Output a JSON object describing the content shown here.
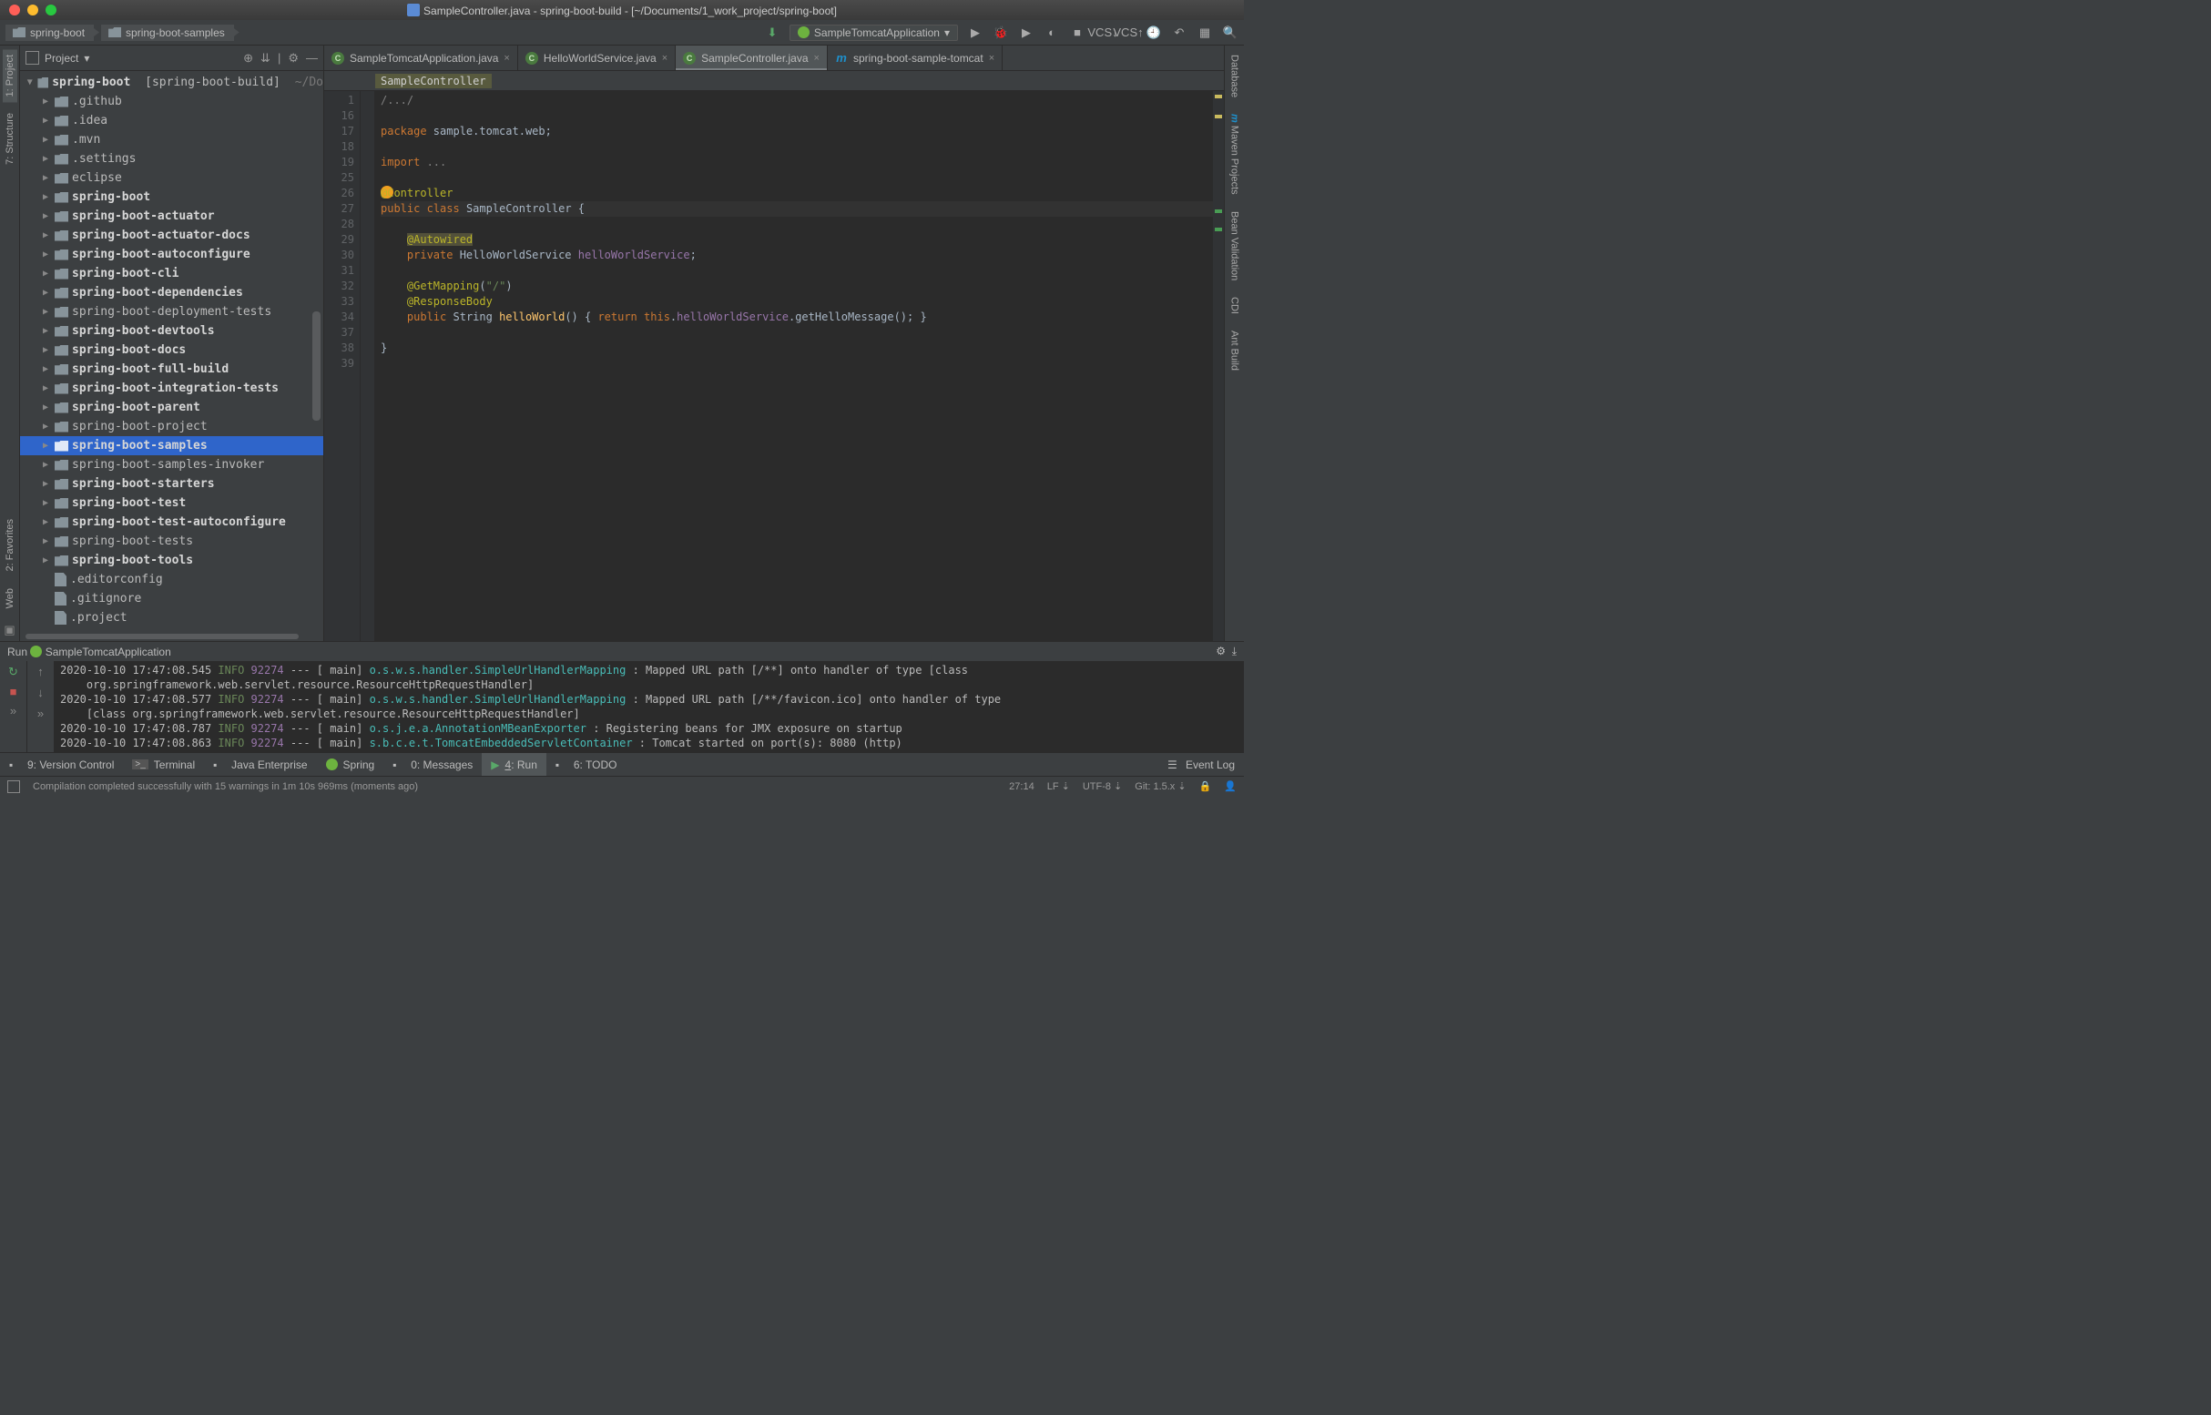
{
  "title": "SampleController.java - spring-boot-build - [~/Documents/1_work_project/spring-boot]",
  "breadcrumb": [
    "spring-boot",
    "spring-boot-samples"
  ],
  "runconfig": "SampleTomcatApplication",
  "leftTools": [
    {
      "label": "1: Project",
      "icon": "project"
    },
    {
      "label": "7: Structure",
      "icon": "structure"
    },
    {
      "label": "2: Favorites",
      "icon": "star"
    },
    {
      "label": "Web",
      "icon": "web"
    }
  ],
  "rightTools": [
    {
      "label": "Database",
      "icon": "db"
    },
    {
      "label": "Maven Projects",
      "icon": "maven"
    },
    {
      "label": "Bean Validation",
      "icon": "bean"
    },
    {
      "label": "CDI",
      "icon": "cdi"
    },
    {
      "label": "Ant Build",
      "icon": "ant"
    }
  ],
  "projectPanel": {
    "title": "Project",
    "root": {
      "name": "spring-boot",
      "qualifier": "[spring-boot-build]",
      "path": "~/Do"
    },
    "items": [
      {
        "name": ".github",
        "bold": false
      },
      {
        "name": ".idea",
        "bold": false
      },
      {
        "name": ".mvn",
        "bold": false
      },
      {
        "name": ".settings",
        "bold": false
      },
      {
        "name": "eclipse",
        "bold": false
      },
      {
        "name": "spring-boot",
        "bold": true
      },
      {
        "name": "spring-boot-actuator",
        "bold": true
      },
      {
        "name": "spring-boot-actuator-docs",
        "bold": true
      },
      {
        "name": "spring-boot-autoconfigure",
        "bold": true
      },
      {
        "name": "spring-boot-cli",
        "bold": true
      },
      {
        "name": "spring-boot-dependencies",
        "bold": true
      },
      {
        "name": "spring-boot-deployment-tests",
        "bold": false
      },
      {
        "name": "spring-boot-devtools",
        "bold": true
      },
      {
        "name": "spring-boot-docs",
        "bold": true
      },
      {
        "name": "spring-boot-full-build",
        "bold": true
      },
      {
        "name": "spring-boot-integration-tests",
        "bold": true
      },
      {
        "name": "spring-boot-parent",
        "bold": true
      },
      {
        "name": "spring-boot-project",
        "bold": false
      },
      {
        "name": "spring-boot-samples",
        "bold": true,
        "selected": true
      },
      {
        "name": "spring-boot-samples-invoker",
        "bold": false
      },
      {
        "name": "spring-boot-starters",
        "bold": true
      },
      {
        "name": "spring-boot-test",
        "bold": true
      },
      {
        "name": "spring-boot-test-autoconfigure",
        "bold": true
      },
      {
        "name": "spring-boot-tests",
        "bold": false
      },
      {
        "name": "spring-boot-tools",
        "bold": true
      }
    ],
    "files": [
      {
        "name": ".editorconfig"
      },
      {
        "name": ".gitignore"
      },
      {
        "name": ".project"
      }
    ]
  },
  "tabs": [
    {
      "label": "SampleTomcatApplication.java",
      "icon": "class",
      "active": false
    },
    {
      "label": "HelloWorldService.java",
      "icon": "class",
      "active": false
    },
    {
      "label": "SampleController.java",
      "icon": "class",
      "active": true
    },
    {
      "label": "spring-boot-sample-tomcat",
      "icon": "m",
      "active": false
    }
  ],
  "crumbBar": "SampleController",
  "gutterLines": [
    "1",
    "16",
    "17",
    "18",
    "19",
    "25",
    "26",
    "27",
    "28",
    "29",
    "30",
    "31",
    "32",
    "33",
    "34",
    "37",
    "38",
    "39"
  ],
  "code": {
    "l1": "/.../",
    "l3_kw": "package",
    "l3_rest": " sample.tomcat.web;",
    "l5_kw": "import",
    "l5_rest": " ...",
    "l7_ann": "@Controller",
    "l8_kw1": "public",
    "l8_kw2": "class",
    "l8_cls": "SampleController",
    "l8_rest": " {",
    "l10_ann": "@Autowired",
    "l11_kw": "private",
    "l11_type": " HelloWorldService ",
    "l11_fld": "helloWorldService",
    "l11_end": ";",
    "l13_ann": "@GetMapping",
    "l13_par": "(",
    "l13_str": "\"/\"",
    "l13_par2": ")",
    "l14_ann": "@ResponseBody",
    "l15_kw": "public",
    "l15_type": " String ",
    "l15_mtd": "helloWorld",
    "l15_rest1": "() { ",
    "l15_kw2": "return ",
    "l15_this": "this",
    "l15_dot": ".",
    "l15_fld": "helloWorldService",
    "l15_dot2": ".getHelloMessage(); }",
    "l17": "}"
  },
  "runHeader": {
    "label": "Run",
    "config": "SampleTomcatApplication"
  },
  "consoleLines": [
    {
      "ts": "2020-10-10 17:47:08.545",
      "lvl": "INFO",
      "pid": "92274",
      "thread": "main",
      "pkg": "o.s.w.s.handler.SimpleUrlHandlerMapping",
      "msg": ": Mapped URL path [/**] onto handler of type [class"
    },
    {
      "cont": "org.springframework.web.servlet.resource.ResourceHttpRequestHandler]"
    },
    {
      "ts": "2020-10-10 17:47:08.577",
      "lvl": "INFO",
      "pid": "92274",
      "thread": "main",
      "pkg": "o.s.w.s.handler.SimpleUrlHandlerMapping",
      "msg": ": Mapped URL path [/**/favicon.ico] onto handler of type"
    },
    {
      "cont": "[class org.springframework.web.servlet.resource.ResourceHttpRequestHandler]"
    },
    {
      "ts": "2020-10-10 17:47:08.787",
      "lvl": "INFO",
      "pid": "92274",
      "thread": "main",
      "pkg": "o.s.j.e.a.AnnotationMBeanExporter",
      "msg": ": Registering beans for JMX exposure on startup"
    },
    {
      "ts": "2020-10-10 17:47:08.863",
      "lvl": "INFO",
      "pid": "92274",
      "thread": "main",
      "pkg": "s.b.c.e.t.TomcatEmbeddedServletContainer",
      "msg": ": Tomcat started on port(s): 8080 (http)"
    }
  ],
  "bottomButtons": [
    {
      "label": "9: Version Control",
      "icon": "vcs"
    },
    {
      "label": "Terminal",
      "icon": "term"
    },
    {
      "label": "Java Enterprise",
      "icon": "jee"
    },
    {
      "label": "Spring",
      "icon": "spring"
    },
    {
      "label": "0: Messages",
      "icon": "msg"
    },
    {
      "label": "4: Run",
      "icon": "run",
      "active": true
    },
    {
      "label": "6: TODO",
      "icon": "todo"
    }
  ],
  "eventLog": "Event Log",
  "status": {
    "msg": "Compilation completed successfully with 15 warnings in 1m 10s 969ms (moments ago)",
    "pos": "27:14",
    "lf": "LF",
    "enc": "UTF-8",
    "git": "Git: 1.5.x"
  }
}
